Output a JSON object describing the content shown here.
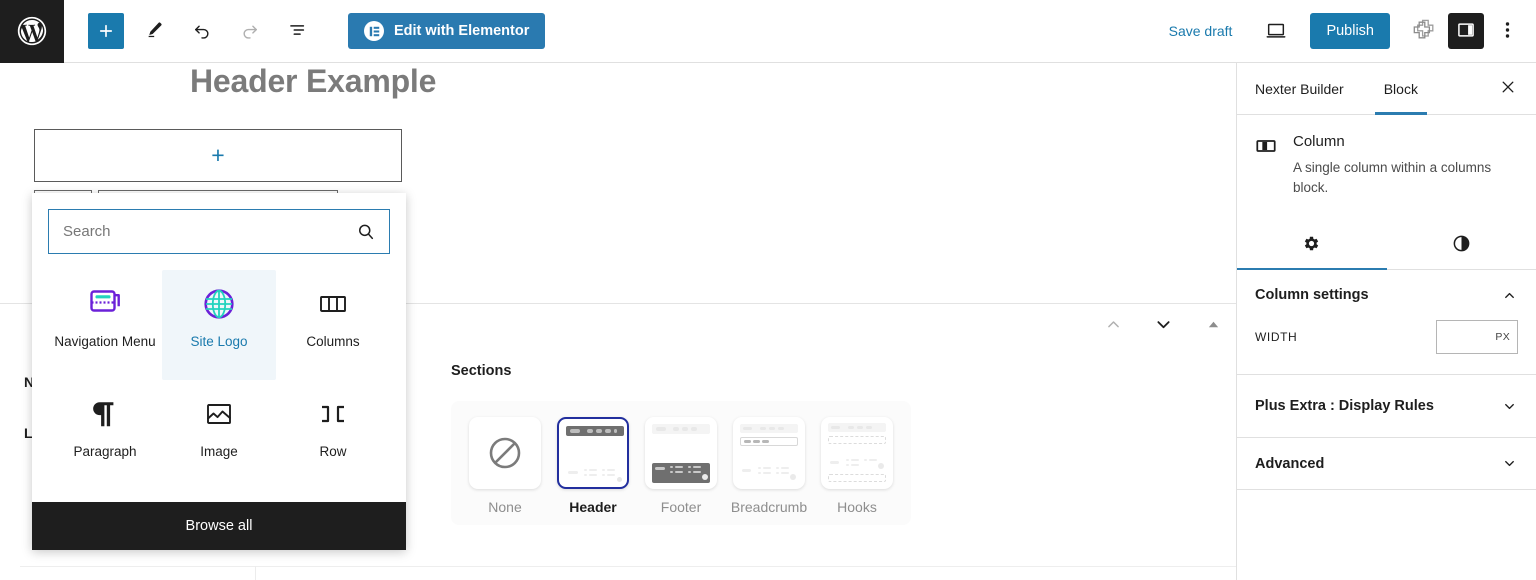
{
  "toolbar": {
    "wp_logo_alt": "WordPress",
    "add_block_label": "+",
    "edit_tool_label": "Edit",
    "undo_label": "Undo",
    "redo_label": "Redo",
    "list_view_label": "List view",
    "elementor_button": "Edit with Elementor",
    "save_draft": "Save draft",
    "preview_label": "Preview",
    "publish": "Publish",
    "plugin_label": "Plus Addons",
    "settings_toggle_label": "Settings",
    "more_menu_label": "Options",
    "accent_blue": "#1a7aad",
    "elementor_blue": "#2a7ab0"
  },
  "canvas": {
    "post_title": "Header Example",
    "appender_plus": "+",
    "hidden_label_n": "N",
    "hidden_label_l": "L",
    "sections": {
      "heading": "Sections",
      "items": [
        {
          "label": "None",
          "selected": false
        },
        {
          "label": "Header",
          "selected": true
        },
        {
          "label": "Footer",
          "selected": false
        },
        {
          "label": "Breadcrumb",
          "selected": false
        },
        {
          "label": "Hooks",
          "selected": false
        }
      ],
      "selected_outline_color": "#222f9e"
    },
    "nav_arrows": [
      "move-up",
      "move-down",
      "collapse"
    ]
  },
  "inserter": {
    "search_placeholder": "Search",
    "search_value": "",
    "blocks": [
      {
        "label": "Navigation Menu",
        "icon": "navigation-menu-icon",
        "active": false
      },
      {
        "label": "Site Logo",
        "icon": "site-logo-icon",
        "active": true
      },
      {
        "label": "Columns",
        "icon": "columns-icon",
        "active": false
      },
      {
        "label": "Paragraph",
        "icon": "paragraph-icon",
        "active": false
      },
      {
        "label": "Image",
        "icon": "image-icon",
        "active": false
      },
      {
        "label": "Row",
        "icon": "row-icon",
        "active": false
      }
    ],
    "browse_all": "Browse all",
    "highlight_color": "#1a7aad",
    "browse_all_bg": "#1e1e1e"
  },
  "sidebar": {
    "tabs": [
      {
        "label": "Nexter Builder",
        "active": false
      },
      {
        "label": "Block",
        "active": true
      }
    ],
    "close_label": "Close settings",
    "block_card": {
      "icon": "column-block-icon",
      "title": "Column",
      "description": "A single column within a columns block."
    },
    "panel_tabs": [
      {
        "icon": "settings-gear-icon",
        "active": true
      },
      {
        "icon": "styles-contrast-icon",
        "active": false
      }
    ],
    "panels": [
      {
        "title": "Column settings",
        "expanded": true,
        "fields": [
          {
            "label": "WIDTH",
            "value": "",
            "unit": "PX"
          }
        ]
      },
      {
        "title": "Plus Extra : Display Rules",
        "expanded": false,
        "fields": []
      },
      {
        "title": "Advanced",
        "expanded": false,
        "fields": []
      }
    ],
    "active_tab_underline": "#2b7cb0"
  }
}
